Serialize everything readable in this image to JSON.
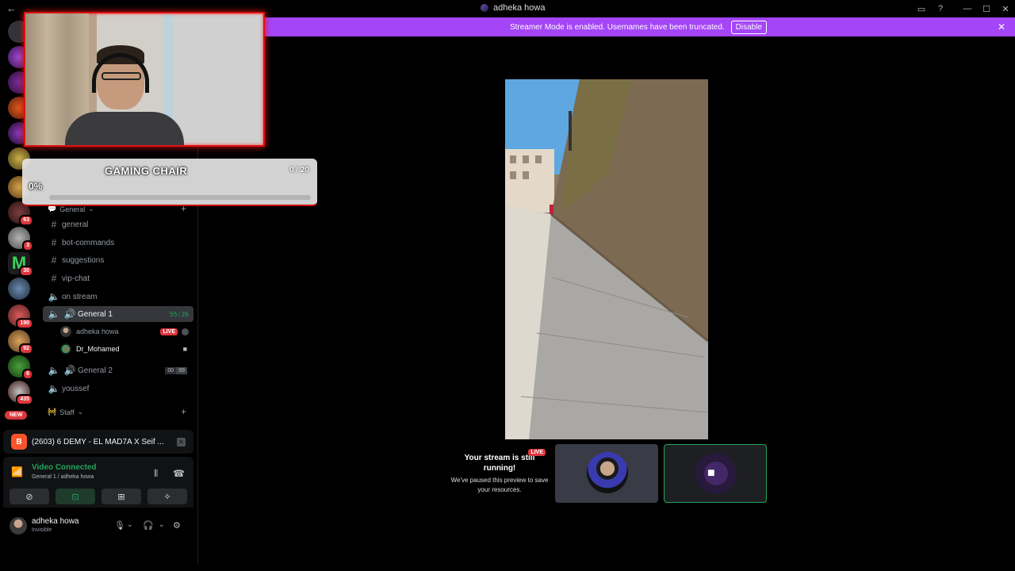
{
  "window": {
    "title": "adheka howa"
  },
  "banner": {
    "text": "Streamer Mode is enabled. Usernames have been truncated.",
    "button": "Disable"
  },
  "rail": {
    "badges": [
      "63",
      "3",
      "30",
      "190",
      "92",
      "6",
      "435"
    ],
    "new_label": "NEW"
  },
  "goal": {
    "title": "GAMING CHAIR",
    "count": "0 / 20",
    "percent_label": "0%",
    "progress": 0
  },
  "sidebar": {
    "categories": {
      "general": "General",
      "staff": "Staff"
    },
    "channels": [
      {
        "name": "general"
      },
      {
        "name": "bot-commands"
      },
      {
        "name": "suggestions"
      },
      {
        "name": "vip-chat"
      },
      {
        "name": "on stream"
      },
      {
        "name": "General 1",
        "timer": "55:26"
      },
      {
        "name": "General 2",
        "count_a": "00",
        "count_b": "99"
      },
      {
        "name": "youssef"
      }
    ],
    "members": [
      {
        "name": "adheka howa",
        "badge": "LIVE"
      },
      {
        "name": "Dr_Mohamed"
      }
    ]
  },
  "activity": {
    "title": "(2603) 6 DEMY - EL MAD7A X Seif ..."
  },
  "voice": {
    "status": "Video Connected",
    "location": "General 1 / adheka howa"
  },
  "user": {
    "name": "adheka howa",
    "status": "Invisible"
  },
  "stream": {
    "paused_title": "Your stream is still running!",
    "paused_desc": "We've paused this preview to save your resources.",
    "live_badge": "LIVE"
  },
  "colors": {
    "accent_banner": "#a445f7",
    "online_green": "#23a55a",
    "live_red": "#da373c"
  }
}
